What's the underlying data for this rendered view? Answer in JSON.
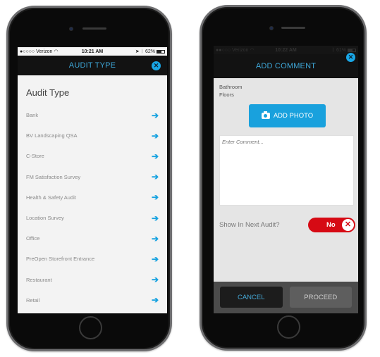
{
  "phone_left": {
    "status_bar": {
      "carrier": "●○○○○ Verizon",
      "wifi": "wifi-icon",
      "time": "10:21 AM",
      "battery": "62%"
    },
    "header": {
      "title": "AUDIT TYPE",
      "close_icon": "close-icon"
    },
    "list": {
      "heading": "Audit Type",
      "items": [
        {
          "label": "Bank"
        },
        {
          "label": "BV Landscaping QSA"
        },
        {
          "label": "C-Store"
        },
        {
          "label": "FM Satisfaction Survey"
        },
        {
          "label": "Health & Safety Audit"
        },
        {
          "label": "Location Survey"
        },
        {
          "label": "Office"
        },
        {
          "label": "PreOpen Storefront Entrance"
        },
        {
          "label": "Restaurant"
        },
        {
          "label": "Retail"
        }
      ],
      "arrow_glyph": "➔"
    }
  },
  "phone_right": {
    "status_bar": {
      "carrier": "●●○○○ Verizon",
      "time": "10:22 AM",
      "battery": "61%"
    },
    "header": {
      "title": "ADD COMMENT",
      "close_icon": "close-icon"
    },
    "location": {
      "line1": "Bathroom",
      "line2": "Floors"
    },
    "add_photo_label": "ADD PHOTO",
    "comment": {
      "placeholder": "Enter Comment...",
      "value": ""
    },
    "show_next_audit": {
      "label": "Show In Next Audit?",
      "toggle_label": "No",
      "state": false
    },
    "footer": {
      "cancel_label": "CANCEL",
      "proceed_label": "PROCEED"
    }
  },
  "colors": {
    "accent_blue": "#19a1dd",
    "toggle_red": "#d60a14",
    "nav_bg": "#121212"
  }
}
